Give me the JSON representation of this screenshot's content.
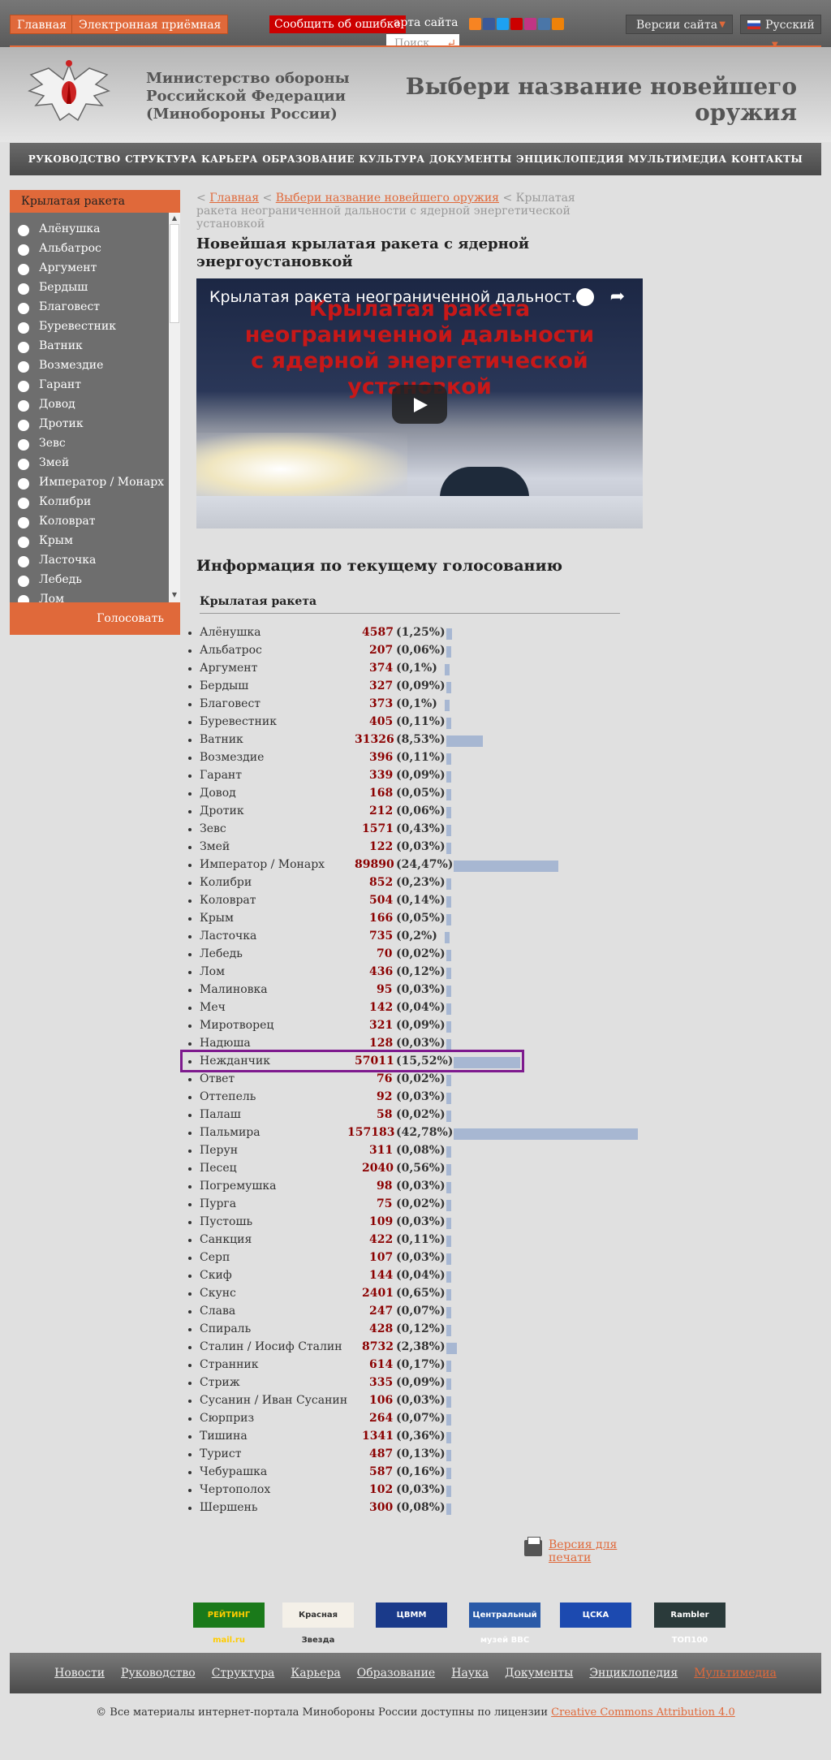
{
  "topbar": {
    "home": "Главная",
    "reception": "Электронная приёмная",
    "report_error": "Сообщить об ошибке",
    "sitemap": "арта сайта",
    "search_placeholder": "Поиск",
    "versions": "Версии сайта",
    "language": "Русский"
  },
  "header": {
    "ministry_line1": "Министерство обороны",
    "ministry_line2": "Российской Федерации",
    "ministry_line3": "(Минобороны России)",
    "slogan_line1": "Выбери название новейшего",
    "slogan_line2": "оружия"
  },
  "nav": [
    "РУКОВОДСТВО",
    "СТРУКТУРА",
    "КАРЬЕРА",
    "ОБРАЗОВАНИЕ",
    "КУЛЬТУРА",
    "ДОКУМЕНТЫ",
    "ЭНЦИКЛОПЕДИЯ",
    "МУЛЬТИМЕДИА",
    "КОНТАКТЫ"
  ],
  "sidebar": {
    "title": "Крылатая ракета",
    "options": [
      "Алёнушка",
      "Альбатрос",
      "Аргумент",
      "Бердыш",
      "Благовест",
      "Буревестник",
      "Ватник",
      "Возмездие",
      "Гарант",
      "Довод",
      "Дротик",
      "Зевс",
      "Змей",
      "Император / Монарх",
      "Колибри",
      "Коловрат",
      "Крым",
      "Ласточка",
      "Лебедь",
      "Лом"
    ],
    "vote_button": "Голосовать"
  },
  "breadcrumb": {
    "home": "Главная",
    "section": "Выбери название новейшего оружия",
    "current": "Крылатая ракета неограниченной дальности с ядерной энергетической установкой"
  },
  "article_title": "Новейшая крылатая ракета с ядерной энергоустановкой",
  "video": {
    "title": "Крылатая ракета неограниченной дальност...",
    "overlay_text": "Крылатая ракета неограниченной дальности с ядерной энергетической установкой"
  },
  "poll": {
    "title": "Информация по текущему голосованию",
    "subtitle": "Крылатая ракета",
    "highlighted": "Нежданчик",
    "rows": [
      {
        "name": "Алёнушка",
        "count": "4587",
        "pct": "(1,25%)",
        "share": 1.25
      },
      {
        "name": "Альбатрос",
        "count": "207",
        "pct": "(0,06%)",
        "share": 0.06
      },
      {
        "name": "Аргумент",
        "count": "374",
        "pct": "(0,1%)",
        "share": 0.1
      },
      {
        "name": "Бердыш",
        "count": "327",
        "pct": "(0,09%)",
        "share": 0.09
      },
      {
        "name": "Благовест",
        "count": "373",
        "pct": "(0,1%)",
        "share": 0.1
      },
      {
        "name": "Буревестник",
        "count": "405",
        "pct": "(0,11%)",
        "share": 0.11
      },
      {
        "name": "Ватник",
        "count": "31326",
        "pct": "(8,53%)",
        "share": 8.53
      },
      {
        "name": "Возмездие",
        "count": "396",
        "pct": "(0,11%)",
        "share": 0.11
      },
      {
        "name": "Гарант",
        "count": "339",
        "pct": "(0,09%)",
        "share": 0.09
      },
      {
        "name": "Довод",
        "count": "168",
        "pct": "(0,05%)",
        "share": 0.05
      },
      {
        "name": "Дротик",
        "count": "212",
        "pct": "(0,06%)",
        "share": 0.06
      },
      {
        "name": "Зевс",
        "count": "1571",
        "pct": "(0,43%)",
        "share": 0.43
      },
      {
        "name": "Змей",
        "count": "122",
        "pct": "(0,03%)",
        "share": 0.03
      },
      {
        "name": "Император / Монарх",
        "count": "89890",
        "pct": "(24,47%)",
        "share": 24.47
      },
      {
        "name": "Колибри",
        "count": "852",
        "pct": "(0,23%)",
        "share": 0.23
      },
      {
        "name": "Коловрат",
        "count": "504",
        "pct": "(0,14%)",
        "share": 0.14
      },
      {
        "name": "Крым",
        "count": "166",
        "pct": "(0,05%)",
        "share": 0.05
      },
      {
        "name": "Ласточка",
        "count": "735",
        "pct": "(0,2%)",
        "share": 0.2
      },
      {
        "name": "Лебедь",
        "count": "70",
        "pct": "(0,02%)",
        "share": 0.02
      },
      {
        "name": "Лом",
        "count": "436",
        "pct": "(0,12%)",
        "share": 0.12
      },
      {
        "name": "Малиновка",
        "count": "95",
        "pct": "(0,03%)",
        "share": 0.03
      },
      {
        "name": "Меч",
        "count": "142",
        "pct": "(0,04%)",
        "share": 0.04
      },
      {
        "name": "Миротворец",
        "count": "321",
        "pct": "(0,09%)",
        "share": 0.09
      },
      {
        "name": "Надюша",
        "count": "128",
        "pct": "(0,03%)",
        "share": 0.03
      },
      {
        "name": "Нежданчик",
        "count": "57011",
        "pct": "(15,52%)",
        "share": 15.52
      },
      {
        "name": "Ответ",
        "count": "76",
        "pct": "(0,02%)",
        "share": 0.02
      },
      {
        "name": "Оттепель",
        "count": "92",
        "pct": "(0,03%)",
        "share": 0.03
      },
      {
        "name": "Палаш",
        "count": "58",
        "pct": "(0,02%)",
        "share": 0.02
      },
      {
        "name": "Пальмира",
        "count": "157183",
        "pct": "(42,78%)",
        "share": 42.78
      },
      {
        "name": "Перун",
        "count": "311",
        "pct": "(0,08%)",
        "share": 0.08
      },
      {
        "name": "Песец",
        "count": "2040",
        "pct": "(0,56%)",
        "share": 0.56
      },
      {
        "name": "Погремушка",
        "count": "98",
        "pct": "(0,03%)",
        "share": 0.03
      },
      {
        "name": "Пурга",
        "count": "75",
        "pct": "(0,02%)",
        "share": 0.02
      },
      {
        "name": "Пустошь",
        "count": "109",
        "pct": "(0,03%)",
        "share": 0.03
      },
      {
        "name": "Санкция",
        "count": "422",
        "pct": "(0,11%)",
        "share": 0.11
      },
      {
        "name": "Серп",
        "count": "107",
        "pct": "(0,03%)",
        "share": 0.03
      },
      {
        "name": "Скиф",
        "count": "144",
        "pct": "(0,04%)",
        "share": 0.04
      },
      {
        "name": "Скунс",
        "count": "2401",
        "pct": "(0,65%)",
        "share": 0.65
      },
      {
        "name": "Слава",
        "count": "247",
        "pct": "(0,07%)",
        "share": 0.07
      },
      {
        "name": "Спираль",
        "count": "428",
        "pct": "(0,12%)",
        "share": 0.12
      },
      {
        "name": "Сталин / Иосиф Сталин",
        "count": "8732",
        "pct": "(2,38%)",
        "share": 2.38
      },
      {
        "name": "Странник",
        "count": "614",
        "pct": "(0,17%)",
        "share": 0.17
      },
      {
        "name": "Стриж",
        "count": "335",
        "pct": "(0,09%)",
        "share": 0.09
      },
      {
        "name": "Сусанин / Иван Сусанин",
        "count": "106",
        "pct": "(0,03%)",
        "share": 0.03
      },
      {
        "name": "Сюрприз",
        "count": "264",
        "pct": "(0,07%)",
        "share": 0.07
      },
      {
        "name": "Тишина",
        "count": "1341",
        "pct": "(0,36%)",
        "share": 0.36
      },
      {
        "name": "Турист",
        "count": "487",
        "pct": "(0,13%)",
        "share": 0.13
      },
      {
        "name": "Чебурашка",
        "count": "587",
        "pct": "(0,16%)",
        "share": 0.16
      },
      {
        "name": "Чертополох",
        "count": "102",
        "pct": "(0,03%)",
        "share": 0.03
      },
      {
        "name": "Шершень",
        "count": "300",
        "pct": "(0,08%)",
        "share": 0.08
      }
    ]
  },
  "print_version": "Версия для печати",
  "banners": [
    {
      "label": "РЕЙТИНГ mail.ru",
      "bg": "#1a7a1a",
      "fg": "#ffcc00"
    },
    {
      "label": "Красная Звезда",
      "bg": "#f4f0e8",
      "fg": "#333333"
    },
    {
      "label": "ЦВММ",
      "bg": "#1a3a8a",
      "fg": "#ffffff"
    },
    {
      "label": "Центральный музей ВВС",
      "bg": "#2a5aa8",
      "fg": "#ffffff"
    },
    {
      "label": "ЦСКА",
      "bg": "#1c4ab0",
      "fg": "#ffffff"
    },
    {
      "label": "Rambler ТОП100",
      "bg": "#2a3a3a",
      "fg": "#ffffff"
    }
  ],
  "footer_nav": [
    "Новости",
    "Руководство",
    "Структура",
    "Карьера",
    "Образование",
    "Наука",
    "Документы",
    "Энциклопедия",
    "Мультимедиа"
  ],
  "copyright": {
    "text": "© Все материалы интернет-портала Минобороны России доступны по лицензии",
    "license": "Creative Commons Attribution 4.0"
  },
  "colors": {
    "accent": "#e0693a",
    "bar": "#a7b7d2",
    "count": "#8b0000",
    "highlight": "#7e1a8e"
  }
}
